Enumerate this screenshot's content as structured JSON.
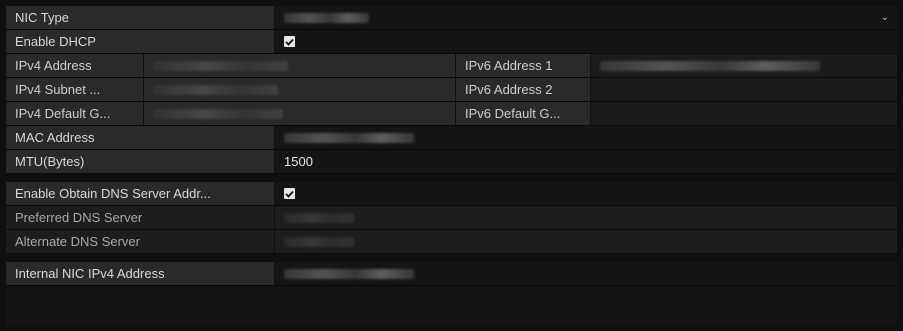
{
  "fields": {
    "nic_type_label": "NIC Type",
    "enable_dhcp_label": "Enable DHCP",
    "enable_dhcp_checked": true,
    "ipv4_address_label": "IPv4 Address",
    "ipv4_subnet_label": "IPv4 Subnet ...",
    "ipv4_gateway_label": "IPv4 Default G...",
    "ipv6_address1_label": "IPv6 Address 1",
    "ipv6_address2_label": "IPv6 Address 2",
    "ipv6_gateway_label": "IPv6 Default G...",
    "mac_address_label": "MAC Address",
    "mtu_label": "MTU(Bytes)",
    "mtu_value": "1500"
  },
  "dns": {
    "auto_dns_label": "Enable Obtain DNS Server Addr...",
    "auto_dns_checked": true,
    "preferred_label": "Preferred DNS Server",
    "alternate_label": "Alternate DNS Server"
  },
  "internal": {
    "nic_ipv4_label": "Internal NIC IPv4 Address"
  },
  "icons": {
    "dropdown": "chevron-down-icon",
    "checkbox": "checkbox-checked-icon"
  },
  "colors": {
    "background": "#0f0f0f",
    "label_bg": "#2a2a2a",
    "value_bg": "#151515",
    "checkbox": "#e6e6e6"
  }
}
